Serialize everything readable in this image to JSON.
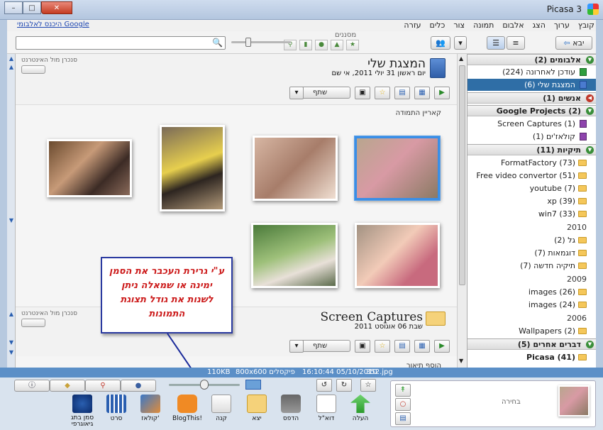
{
  "window": {
    "title": "Picasa 3",
    "close_glyph": "✕",
    "maximize_glyph": "□",
    "minimize_glyph": "–"
  },
  "menu": {
    "items": [
      "קובץ",
      "ערוך",
      "הצג",
      "אלבום",
      "תמונה",
      "צור",
      "כלים",
      "עזרה"
    ],
    "google_link": "היכנס לאלבומי Google"
  },
  "toolbar": {
    "import_label": "יבא",
    "filters_label": "מסננים",
    "search_placeholder": ""
  },
  "main": {
    "album_title": "המצגת שלי",
    "album_date": "יום ראשון 31 יולי 2011, אי שם",
    "sync_label": "סנכרן מול האינטרנט",
    "share_label": "שתף",
    "caption_placeholder": "קאריין התמודה",
    "second_album_title": "Screen Captures",
    "second_album_date": "שבת 06 אוגוסט 2011",
    "second_sync_label": "סנכרן מול האינטרנט",
    "second_share_label": "שתף",
    "add_description": "הוסף תיאור"
  },
  "callout": {
    "text": "ע\"י גרירת העכבר את הסמן ימינה או שמאלה ניתן לשנות את גודל תצוגת התמונות"
  },
  "sidebar": {
    "albums_header": "אלבומים (2)",
    "album_items": [
      {
        "label": "עודכן לאחרונה (224)"
      },
      {
        "label": "המצגת שלי (6)"
      }
    ],
    "people_header": "אנשים (1)",
    "projects_header": "Google Projects (2)",
    "project_items": [
      {
        "label": "Screen Captures (1)"
      },
      {
        "label": "קולאז'ים (1)"
      }
    ],
    "folders_header": "תיקיות (11)",
    "folder_items": [
      {
        "label": "FormatFactory (73)"
      },
      {
        "label": "Free video convertor (51)"
      },
      {
        "label": "youtube (7)"
      },
      {
        "label": "xp (39)"
      },
      {
        "label": "win7 (33)"
      }
    ],
    "year_2010": "2010",
    "folders_2010": [
      {
        "label": "גל (2)"
      },
      {
        "label": "דוגמאות (7)"
      },
      {
        "label": "תיקיה חדשה (7)"
      }
    ],
    "year_2009": "2009",
    "folders_2009": [
      {
        "label": "images (26)"
      },
      {
        "label": "images (24)"
      }
    ],
    "year_2006": "2006",
    "folders_2006": [
      {
        "label": "Wallpapers (2)"
      }
    ],
    "other_header": "דברים אחרים (5)",
    "other_items": [
      {
        "label": "Picasa (41)"
      }
    ]
  },
  "status": {
    "filename": "352.jpg",
    "datetime": "16:10:44 05/10/2010",
    "dimensions": "800x600 פיקסלים",
    "filesize": "110KB"
  },
  "bottom": {
    "selection_label": "בחירה",
    "actions": [
      "העלה",
      "דוא\"ל",
      "הדפס",
      "יצא",
      "קנה",
      "BlogThis!",
      "קולאז'",
      "סרט",
      "סמן בתג גיאוגרפי"
    ]
  }
}
